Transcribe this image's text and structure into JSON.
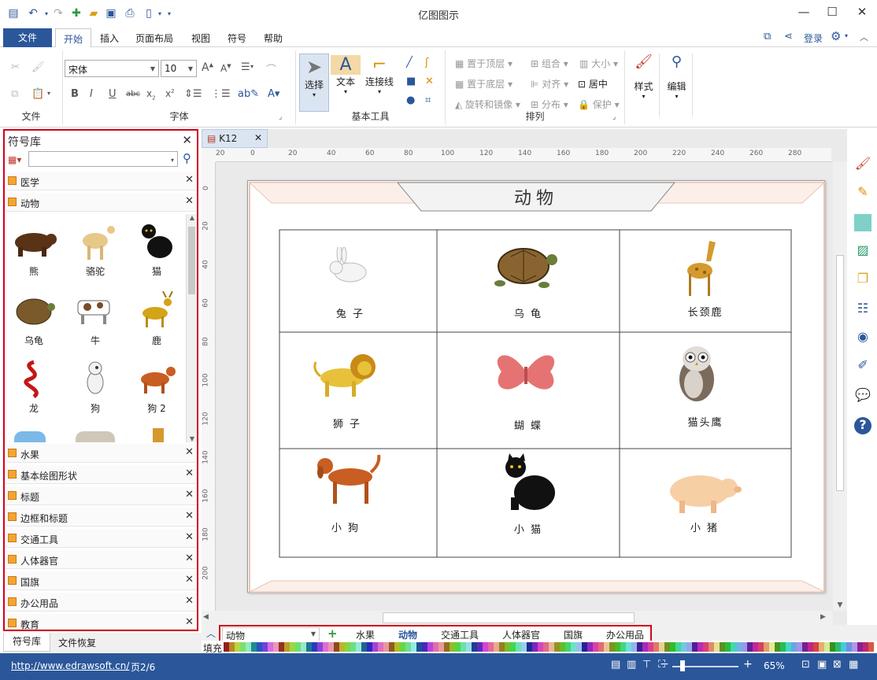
{
  "app": {
    "title": "亿图图示"
  },
  "menu": {
    "file": "文件",
    "tabs": [
      "开始",
      "插入",
      "页面布局",
      "视图",
      "符号",
      "帮助"
    ],
    "login": "登录"
  },
  "ribbon": {
    "groups": {
      "file": "文件",
      "font": "字体",
      "tools": "基本工具",
      "arrange": "排列"
    },
    "font_name": "宋体",
    "font_size": "10",
    "select": "选择",
    "text": "文本",
    "connector": "连接线",
    "arrange_items": [
      "置于顶层",
      "组合",
      "大小",
      "置于底层",
      "对齐",
      "居中",
      "旋转和镜像",
      "分布",
      "保护"
    ],
    "style": "样式",
    "edit": "编辑"
  },
  "library": {
    "title": "符号库",
    "categories_top": [
      "医学",
      "动物"
    ],
    "symbols": [
      "熊",
      "骆驼",
      "猫",
      "乌龟",
      "牛",
      "鹿",
      "龙",
      "狗",
      "狗 2"
    ],
    "categories_bottom": [
      "水果",
      "基本绘图形状",
      "标题",
      "边框和标题",
      "交通工具",
      "人体器官",
      "国旗",
      "办公用品",
      "教育"
    ],
    "bottom_tabs": [
      "符号库",
      "文件恢复"
    ]
  },
  "document": {
    "tab": "K12",
    "heading": "动物",
    "cells": [
      "兔 子",
      "乌 龟",
      "长颈鹿",
      "狮 子",
      "蝴 蝶",
      "猫头鹰",
      "小 狗",
      "小 猫",
      "小 猪"
    ],
    "ruler_h": [
      "20",
      "0",
      "20",
      "40",
      "60",
      "80",
      "100",
      "120",
      "140",
      "160",
      "180",
      "200",
      "220",
      "240",
      "260",
      "280"
    ],
    "ruler_v": [
      "0",
      "20",
      "40",
      "60",
      "80",
      "100",
      "120",
      "140",
      "160",
      "180",
      "200"
    ]
  },
  "pages": {
    "current": "动物",
    "tabs": [
      "水果",
      "动物",
      "交通工具",
      "人体器官",
      "国旗",
      "办公用品"
    ],
    "fill_label": "填充"
  },
  "status": {
    "url": "http://www.edrawsoft.cn/",
    "page": "页2/6",
    "zoom": "65%"
  },
  "colors": {
    "accent": "#2b579a",
    "highlight": "#d0021b"
  }
}
